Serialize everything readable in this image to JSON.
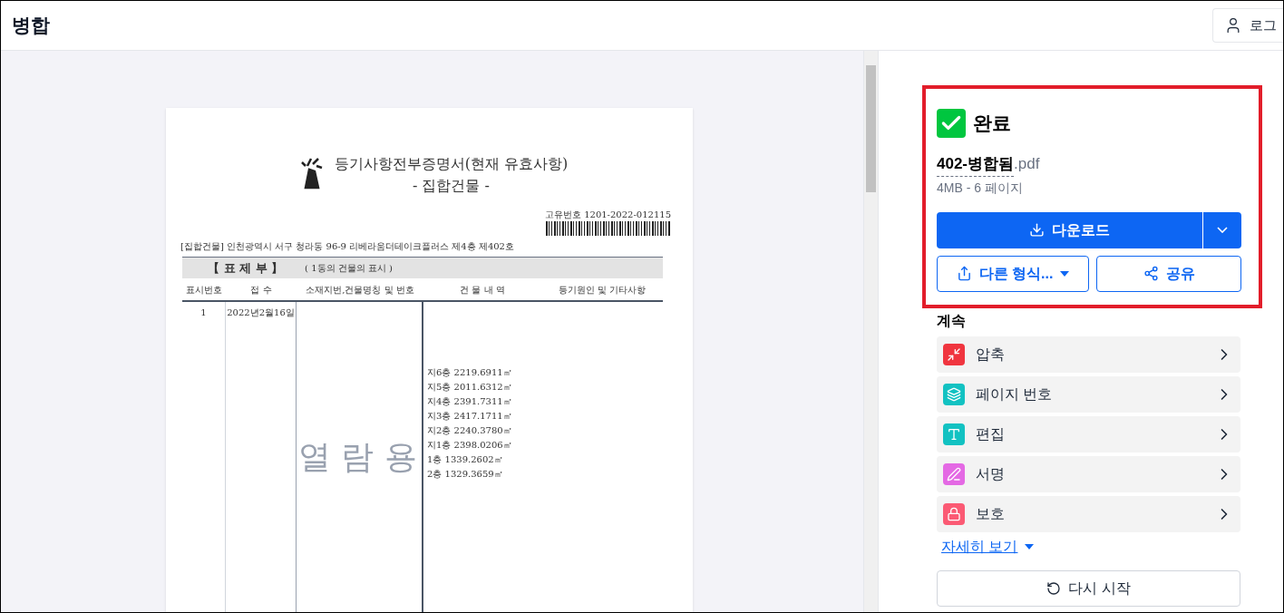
{
  "header": {
    "title": "병합",
    "login": "로그"
  },
  "document": {
    "title": "등기사항전부증명서(현재 유효사항)",
    "subtitle": "- 집합건물 -",
    "serial": "고유번호 1201-2022-012115",
    "address": "[집합건물] 인천광역시 서구 청라동 96-9 리베라움더테이크플러스 제4층 제402호",
    "section": "【 표 제 부 】",
    "section_note": "( 1동의 건물의 표시 )",
    "columns": [
      "표시번호",
      "접 수",
      "소재지번,건물명칭 및 번호",
      "건 물 내 역",
      "등기원인 및 기타사항"
    ],
    "row": {
      "number": "1",
      "date": "2022년2월16일",
      "lines": [
        "지6층 2219.6911㎡",
        "지5층 2011.6312㎡",
        "지4층 2391.7311㎡",
        "지3층 2417.1711㎡",
        "지2층 2240.3780㎡",
        "지1층 2398.0206㎡",
        "1층 1339.2602㎡",
        "2층 1329.3659㎡"
      ]
    },
    "watermark": "열 람 용"
  },
  "result": {
    "status": "완료",
    "file_name": "402-병합됨",
    "file_ext": ".pdf",
    "file_info": "4MB - 6 페이지",
    "download": "다운로드",
    "other_format": "다른 형식...",
    "share": "공유"
  },
  "continue": {
    "heading": "계속",
    "items": [
      {
        "kind": "compress",
        "label": "압축",
        "color": "#f0353f"
      },
      {
        "kind": "numbers",
        "label": "페이지 번호",
        "color": "#12c2c2"
      },
      {
        "kind": "edit",
        "label": "편집",
        "color": "#12c2c2"
      },
      {
        "kind": "sign",
        "label": "서명",
        "color": "#e469e4"
      },
      {
        "kind": "protect",
        "label": "보호",
        "color": "#fb5a74"
      }
    ],
    "more": "자세히 보기",
    "restart": "다시 시작"
  }
}
